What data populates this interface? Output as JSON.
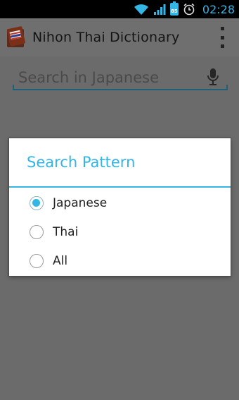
{
  "status_bar": {
    "time": "02:28",
    "battery_level": "85",
    "icons": [
      "wifi-icon",
      "signal-icon",
      "battery-icon",
      "alarm-icon"
    ]
  },
  "action_bar": {
    "title": "Nihon Thai Dictionary",
    "icons": [
      "app-icon",
      "overflow-menu-icon"
    ]
  },
  "search": {
    "placeholder": "Search in Japanese",
    "value": ""
  },
  "dialog": {
    "title": "Search Pattern",
    "options": [
      {
        "label": "Japanese",
        "selected": true
      },
      {
        "label": "Thai",
        "selected": false
      },
      {
        "label": "All",
        "selected": false
      }
    ]
  },
  "colors": {
    "accent": "#33b5e5",
    "scrim": "#6b6b6b"
  }
}
